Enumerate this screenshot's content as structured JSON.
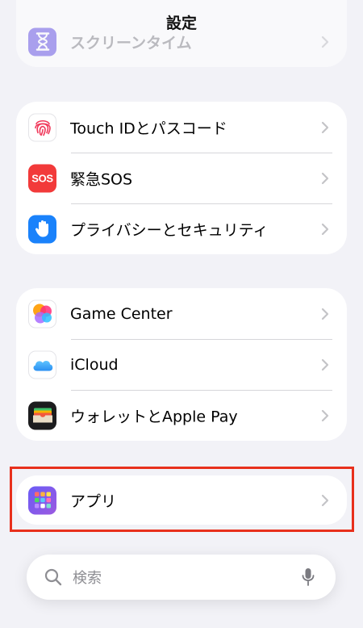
{
  "nav": {
    "title": "設定"
  },
  "top_group": {
    "partial_label": "スクリーンタイム",
    "icon": "hourglass-icon"
  },
  "security_group": {
    "items": [
      {
        "label": "Touch IDとパスコード",
        "icon": "fingerprint-icon"
      },
      {
        "label": "緊急SOS",
        "icon": "sos-icon",
        "icon_text": "SOS"
      },
      {
        "label": "プライバシーとセキュリティ",
        "icon": "hand-icon"
      }
    ]
  },
  "services_group": {
    "items": [
      {
        "label": "Game Center",
        "icon": "game-center-icon"
      },
      {
        "label": "iCloud",
        "icon": "icloud-icon"
      },
      {
        "label": "ウォレットとApple Pay",
        "icon": "wallet-icon"
      }
    ]
  },
  "apps_group": {
    "items": [
      {
        "label": "アプリ",
        "icon": "apps-grid-icon"
      }
    ]
  },
  "search": {
    "placeholder": "検索"
  },
  "colors": {
    "background": "#f2f2f7",
    "highlight": "#e8301c",
    "sos_red": "#f23a3a",
    "privacy_blue": "#1a82fb",
    "screen_time_purple": "#6e5ce6"
  }
}
